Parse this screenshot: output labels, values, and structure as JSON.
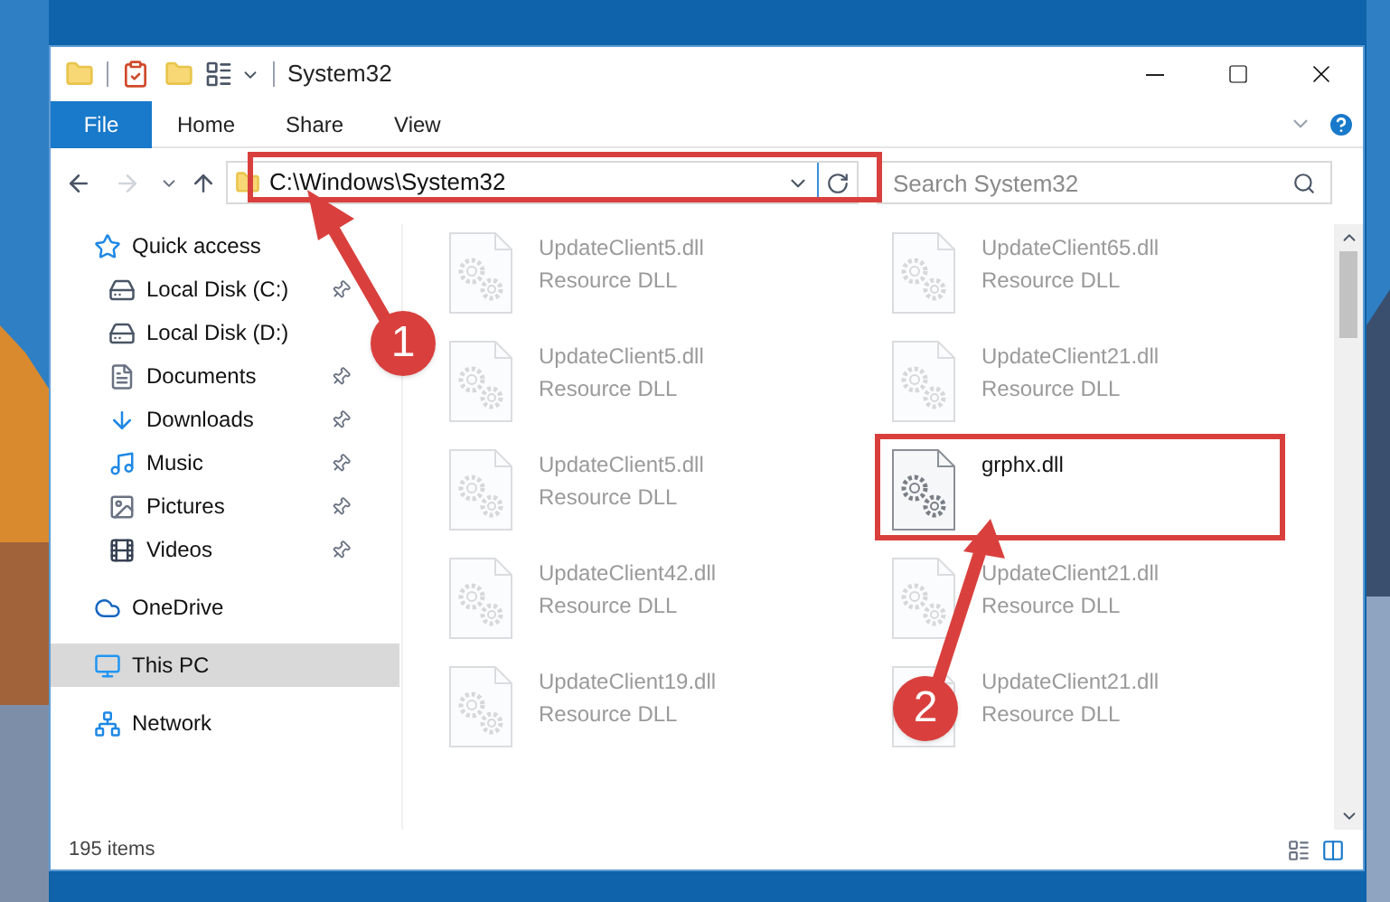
{
  "window": {
    "title": "System32"
  },
  "ribbon": {
    "file_tab": "File",
    "tabs": [
      {
        "label": "Home",
        "selected": false
      },
      {
        "label": "Share",
        "selected": false
      },
      {
        "label": "View",
        "selected": false
      }
    ]
  },
  "address": {
    "path": "C:\\Windows\\System32"
  },
  "search": {
    "placeholder": "Search System32"
  },
  "sidebar": {
    "items": [
      {
        "label": "Quick access",
        "kind": "star",
        "selected": false,
        "children": [
          {
            "label": "Local Disk (C:)",
            "kind": "windrive",
            "selected": false,
            "pinned": true
          },
          {
            "label": "Local Disk (D:)",
            "kind": "drive",
            "selected": false,
            "pinned": false
          },
          {
            "label": "Documents",
            "kind": "documents",
            "selected": false,
            "pinned": true
          },
          {
            "label": "Downloads",
            "kind": "downloads",
            "selected": false,
            "pinned": true
          },
          {
            "label": "Music",
            "kind": "music",
            "selected": false,
            "pinned": true
          },
          {
            "label": "Pictures",
            "kind": "pictures",
            "selected": false,
            "pinned": true
          },
          {
            "label": "Videos",
            "kind": "videos",
            "selected": false,
            "pinned": true
          }
        ]
      },
      {
        "label": "OneDrive",
        "kind": "cloud",
        "selected": false
      },
      {
        "label": "This PC",
        "kind": "pc",
        "selected": true
      },
      {
        "label": "Network",
        "kind": "network",
        "selected": false
      }
    ]
  },
  "files": [
    {
      "name": "UpdateClient5.dll",
      "type": "Resource DLL",
      "faded": true
    },
    {
      "name": "UpdateClient65.dll",
      "type": "Resource DLL",
      "faded": true
    },
    {
      "name": "UpdateClient5.dll",
      "type": "Resource DLL",
      "faded": true
    },
    {
      "name": "UpdateClient21.dll",
      "type": "Resource DLL",
      "faded": true
    },
    {
      "name": "UpdateClient5.dll",
      "type": "Resource DLL",
      "faded": true
    },
    {
      "name": "grphx.dll",
      "faded": false,
      "highlighted": true
    },
    {
      "name": "UpdateClient42.dll",
      "type": "Resource DLL",
      "faded": true
    },
    {
      "name": "UpdateClient21.dll",
      "type": "Resource DLL",
      "faded": true
    },
    {
      "name": "UpdateClient19.dll",
      "type": "Resource DLL",
      "faded": true
    },
    {
      "name": "UpdateClient21.dll",
      "type": "Resource DLL",
      "faded": true
    }
  ],
  "status_bar": {
    "count": "195 items"
  },
  "callouts": [
    {
      "number": "1"
    },
    {
      "number": "2"
    }
  ]
}
